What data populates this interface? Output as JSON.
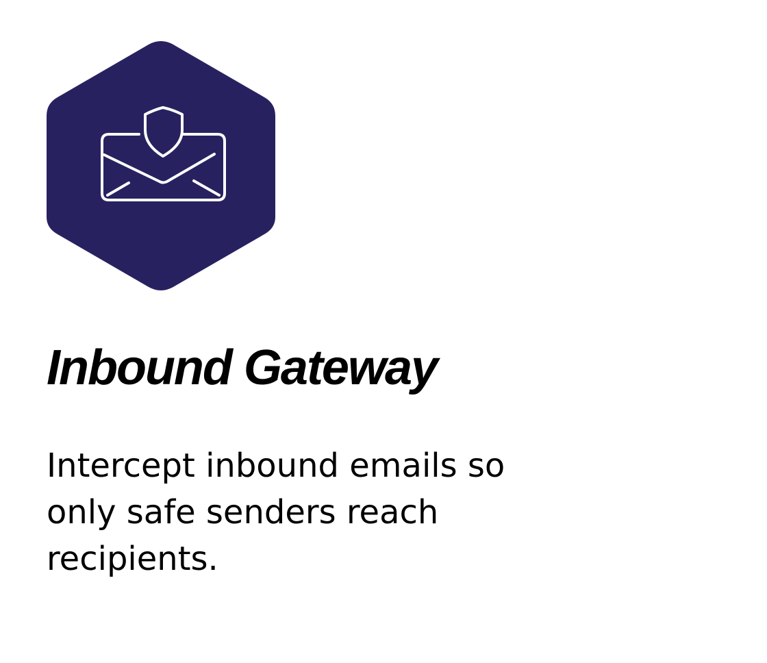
{
  "card": {
    "icon": "shielded-envelope-icon",
    "badge_color": "#27225f",
    "icon_color": "#ffffff",
    "title": "Inbound Gateway",
    "description": "Intercept inbound emails so only safe senders reach recipients."
  }
}
